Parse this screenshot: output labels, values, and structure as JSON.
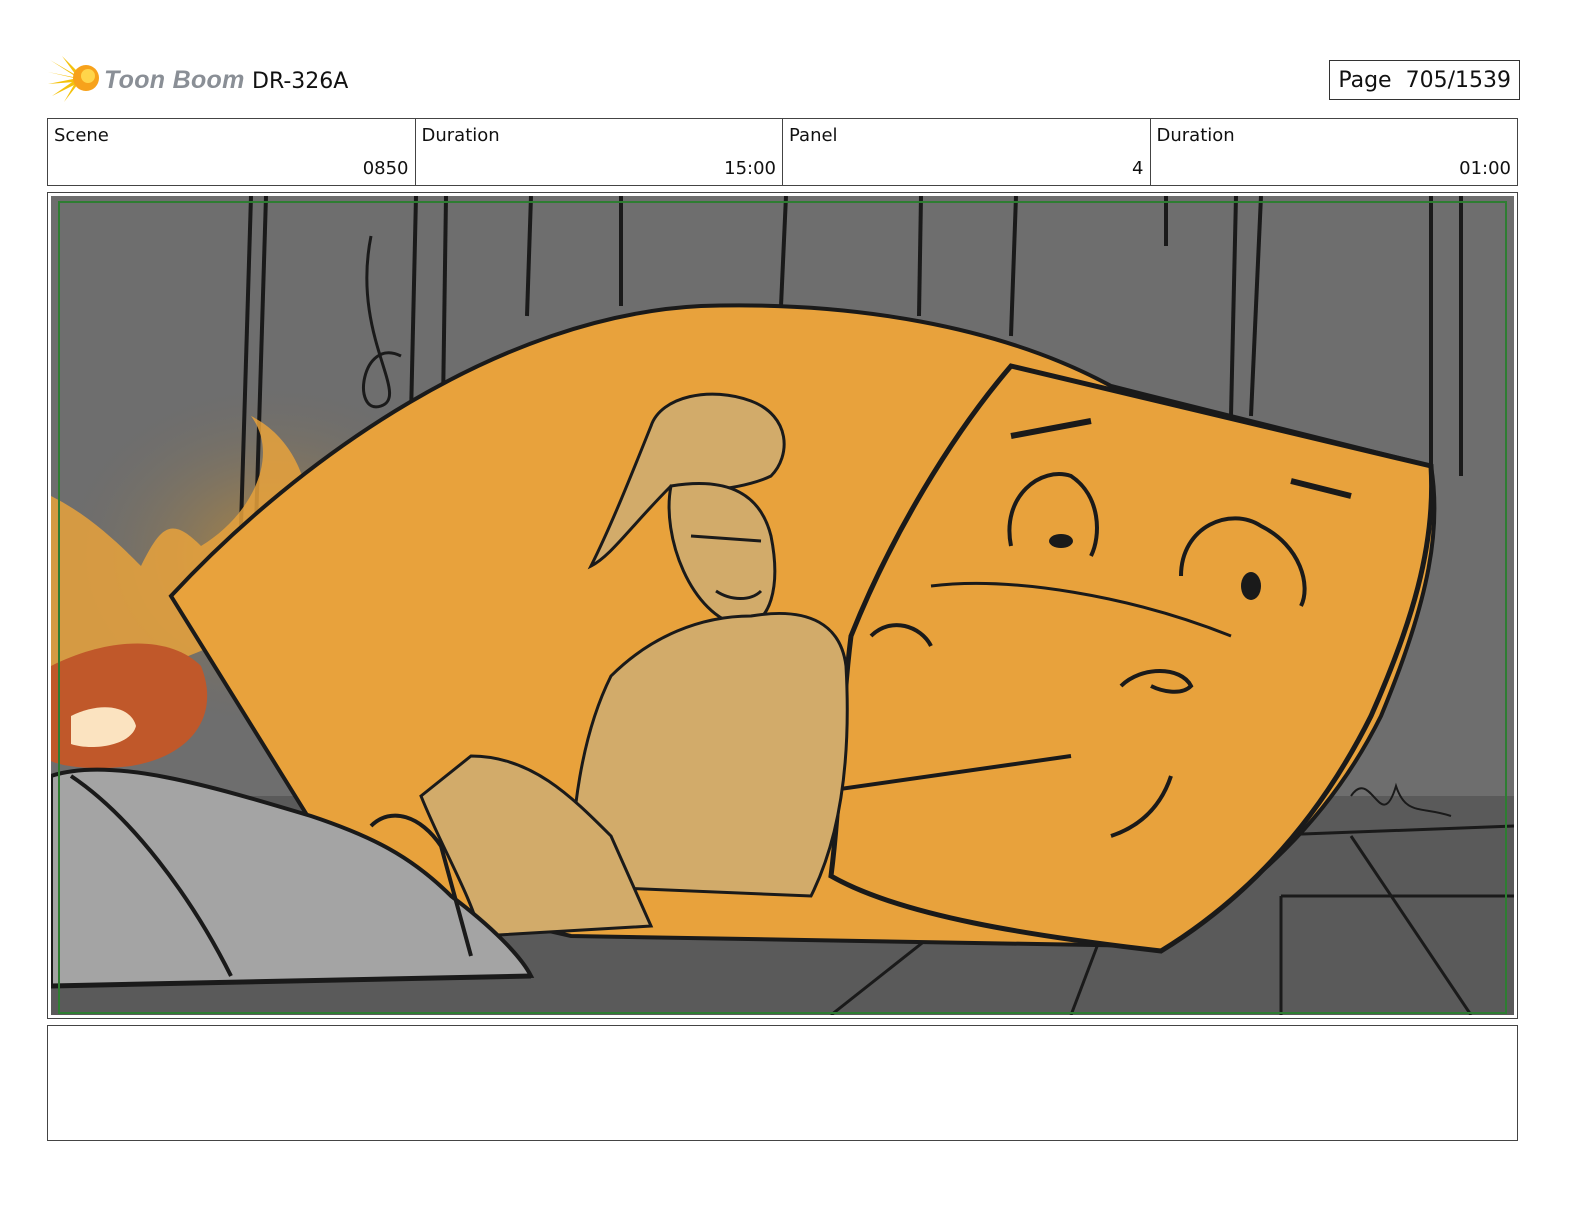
{
  "header": {
    "logo_text": "Toon Boom",
    "project_id": "DR-326A",
    "page_label": "Page",
    "page_value": "705/1539"
  },
  "info": {
    "scene_label": "Scene",
    "scene_value": "0850",
    "scene_duration_label": "Duration",
    "scene_duration_value": "15:00",
    "panel_label": "Panel",
    "panel_value": "4",
    "panel_duration_label": "Duration",
    "panel_duration_value": "01:00"
  },
  "colors": {
    "frame_border": "#2e7d32",
    "creature_orange": "#e8a23c",
    "character_tan": "#d2ab6a",
    "background_gray": "#6b6b6b"
  },
  "notes": {
    "text": ""
  }
}
